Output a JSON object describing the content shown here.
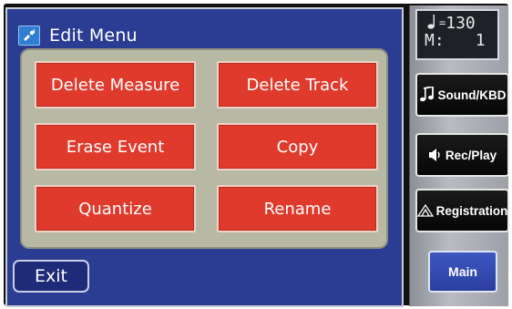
{
  "header": {
    "title": "Edit Menu",
    "icon": "music-edit-icon"
  },
  "menu": {
    "buttons": [
      {
        "label": "Delete Measure"
      },
      {
        "label": "Delete Track"
      },
      {
        "label": "Erase Event"
      },
      {
        "label": "Copy"
      },
      {
        "label": "Quantize"
      },
      {
        "label": "Rename"
      }
    ]
  },
  "footer": {
    "exit_label": "Exit"
  },
  "status": {
    "tempo_value": "130",
    "measure_prefix": "M:",
    "measure_value": "1"
  },
  "sidebar": {
    "buttons": [
      {
        "label": "Sound/KBD",
        "icon": "music-note-icon"
      },
      {
        "label": "Rec/Play",
        "icon": "speaker-icon"
      },
      {
        "label": "Registration",
        "icon": "registration-icon"
      }
    ],
    "main_label": "Main"
  },
  "colors": {
    "panel_bg": "#2b3d93",
    "button_red": "#df3a2c",
    "menu_box": "#b7b9a4",
    "main_button": "#2f47aa"
  }
}
